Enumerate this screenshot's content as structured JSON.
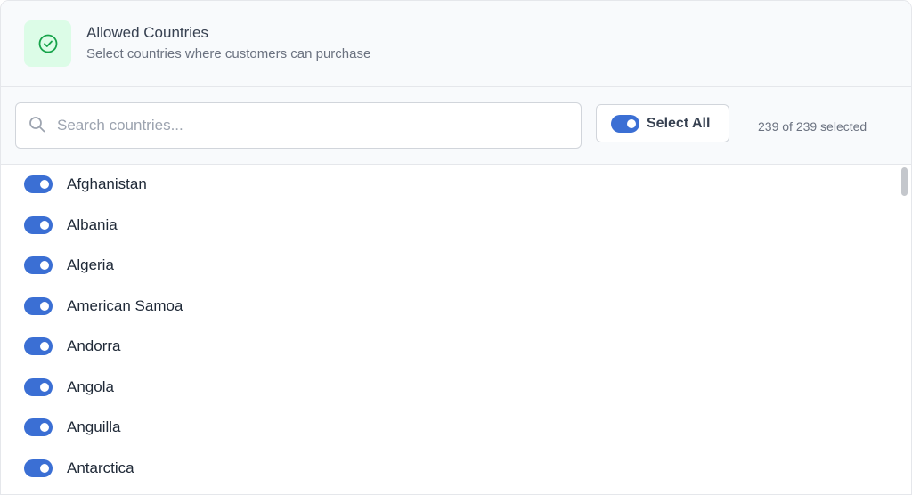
{
  "header": {
    "title": "Allowed Countries",
    "subtitle": "Select countries where customers can purchase",
    "icon": "check-circle-icon",
    "icon_color": "#16a34a",
    "icon_bg": "#dcfce7"
  },
  "search": {
    "placeholder": "Search countries...",
    "value": ""
  },
  "select_all": {
    "label": "Select All",
    "checked": true
  },
  "count_text": "239 of 239 selected",
  "accent_color": "#3b6fd4",
  "countries": [
    {
      "name": "Afghanistan",
      "enabled": true
    },
    {
      "name": "Albania",
      "enabled": true
    },
    {
      "name": "Algeria",
      "enabled": true
    },
    {
      "name": "American Samoa",
      "enabled": true
    },
    {
      "name": "Andorra",
      "enabled": true
    },
    {
      "name": "Angola",
      "enabled": true
    },
    {
      "name": "Anguilla",
      "enabled": true
    },
    {
      "name": "Antarctica",
      "enabled": true
    }
  ]
}
